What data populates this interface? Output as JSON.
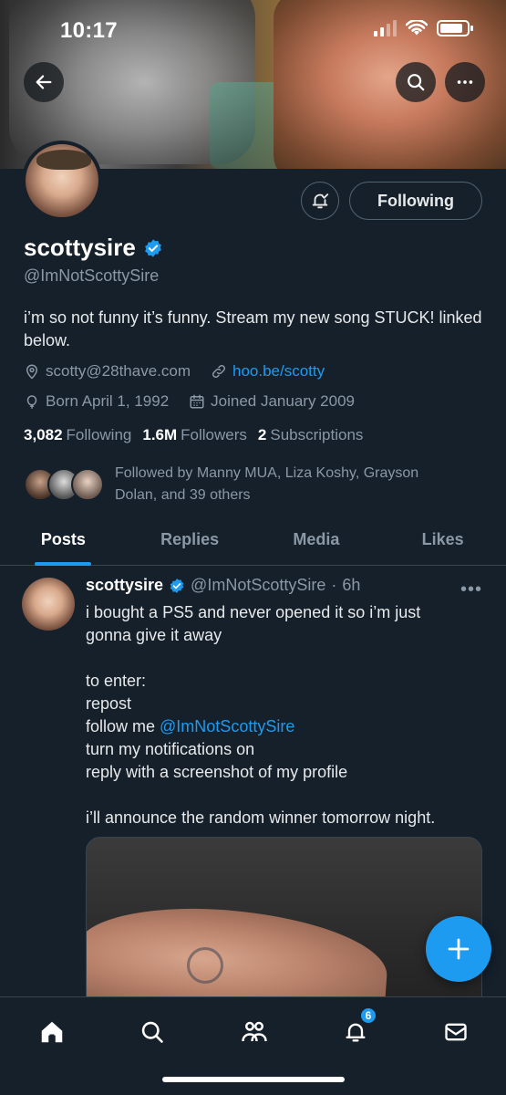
{
  "status_bar": {
    "time": "10:17"
  },
  "header": {
    "back_icon": "arrow-left-icon",
    "search_icon": "search-icon",
    "more_icon": "more-horizontal-icon"
  },
  "profile": {
    "display_name": "scottysire",
    "handle": "@ImNotScottySire",
    "bio": "i’m so not funny it’s funny. Stream my new song STUCK! linked below.",
    "email": "scotty@28thave.com",
    "link": "hoo.be/scotty",
    "birthday": "Born April 1, 1992",
    "joined": "Joined January 2009",
    "following_count": "3,082",
    "following_label": "Following",
    "followers_count": "1.6M",
    "followers_label": "Followers",
    "subscriptions_count": "2",
    "subscriptions_label": "Subscriptions",
    "followed_by": "Followed by Manny MUA, Liza Koshy, Grayson Dolan, and 39 others",
    "follow_button": "Following",
    "accent_color": "#1d9bf0"
  },
  "tabs": [
    {
      "label": "Posts",
      "active": true
    },
    {
      "label": "Replies",
      "active": false
    },
    {
      "label": "Media",
      "active": false
    },
    {
      "label": "Likes",
      "active": false
    }
  ],
  "post": {
    "name": "scottysire",
    "handle": "@ImNotScottySire",
    "separator": "·",
    "time": "6h",
    "lines": [
      "i bought a PS5 and never opened it so i’m just",
      "gonna give it away",
      "",
      "to enter:",
      "repost",
      "follow me ",
      "turn my notifications on",
      "reply with a screenshot of my profile",
      "",
      "i’ll announce the random winner tomorrow night."
    ],
    "mention": "@ImNotScottySire"
  },
  "bottom_nav": {
    "notifications_badge": "6"
  }
}
